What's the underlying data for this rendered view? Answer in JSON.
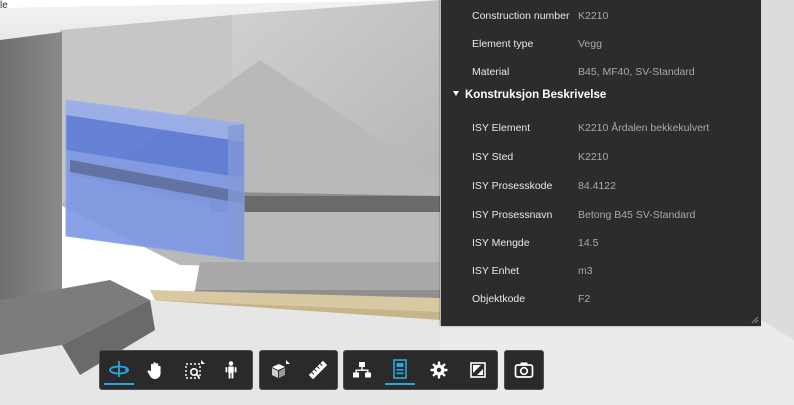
{
  "left_edge_text": "le",
  "properties": {
    "rows": [
      {
        "key": "Construction number",
        "value": "K2210"
      },
      {
        "key": "Element type",
        "value": "Vegg"
      },
      {
        "key": "Material",
        "value": "B45, MF40, SV-Standard"
      }
    ],
    "section_title": "Konstruksjon Beskrivelse",
    "section_rows": [
      {
        "key": "ISY Element",
        "value": "K2210 Årdalen bekkekulvert"
      },
      {
        "key": "ISY Sted",
        "value": "K2210"
      },
      {
        "key": "ISY Prosesskode",
        "value": "84.4122"
      },
      {
        "key": "ISY Prosessnavn",
        "value": "Betong B45 SV-Standard"
      },
      {
        "key": "ISY Mengde",
        "value": "14.5"
      },
      {
        "key": "ISY Enhet",
        "value": "m3"
      },
      {
        "key": "Objektkode",
        "value": "F2"
      }
    ]
  },
  "toolbar": {
    "groups": [
      {
        "name": "navigation",
        "tools": [
          "orbit-icon",
          "pan-hand-icon",
          "fit-to-view-icon",
          "first-person-walk-icon"
        ]
      },
      {
        "name": "model",
        "tools": [
          "explode-model-icon",
          "measure-ruler-icon"
        ]
      },
      {
        "name": "panels",
        "tools": [
          "model-browser-icon",
          "properties-icon",
          "settings-gear-icon",
          "fullscreen-icon"
        ]
      },
      {
        "name": "capture",
        "tools": [
          "camera-icon"
        ]
      }
    ],
    "active_tools": [
      "orbit-icon",
      "properties-icon"
    ],
    "accent_color": "#29a8e0"
  },
  "colors": {
    "panel_bg": "#2c2c2c",
    "selection_blue": "#4f73d9",
    "toolbar_bg": "#2a2a2a"
  }
}
